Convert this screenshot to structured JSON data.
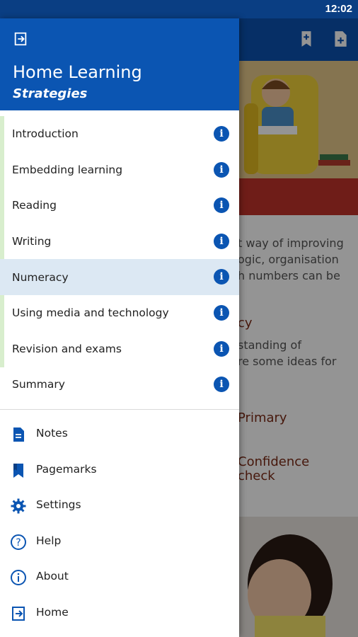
{
  "status_bar": {
    "time": "12:02"
  },
  "background": {
    "text_line1": "t way of improving",
    "text_line2": "ogic, organisation",
    "text_line3": "h numbers can be",
    "heading1": "cy",
    "text_line4": "standing of",
    "text_line5": "re some ideas for",
    "heading2": "Primary",
    "heading3_line1": "Confidence",
    "heading3_line2": "check"
  },
  "drawer": {
    "title": "Home Learning",
    "subtitle": "Strategies",
    "chapters": [
      {
        "label": "Introduction"
      },
      {
        "label": "Embedding learning"
      },
      {
        "label": "Reading"
      },
      {
        "label": "Writing"
      },
      {
        "label": "Numeracy"
      },
      {
        "label": "Using media and technology"
      },
      {
        "label": "Revision and exams"
      },
      {
        "label": "Summary"
      }
    ],
    "active_chapter": "Numeracy",
    "menu": [
      {
        "label": "Notes",
        "icon": "notes-icon"
      },
      {
        "label": "Pagemarks",
        "icon": "bookmark-icon"
      },
      {
        "label": "Settings",
        "icon": "gear-icon"
      },
      {
        "label": "Help",
        "icon": "help-icon"
      },
      {
        "label": "About",
        "icon": "info-icon"
      },
      {
        "label": "Home",
        "icon": "home-exit-icon"
      }
    ]
  },
  "colors": {
    "primary": "#0b55b2",
    "status_bar": "#0a3e83",
    "active_row": "#dce8f3",
    "progress": "#d8eecd"
  }
}
